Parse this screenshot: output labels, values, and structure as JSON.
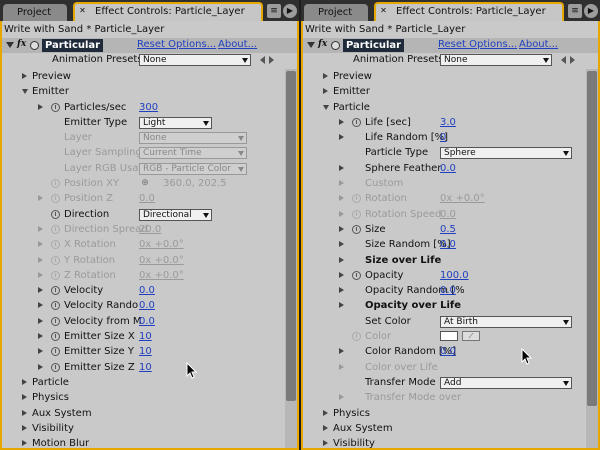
{
  "left": {
    "tabs": {
      "project": "Project",
      "effect_controls": "Effect Controls: Particle_Layer"
    },
    "breadcrumb": "Write with Sand * Particle_Layer",
    "effect": {
      "name": "Particular",
      "reset": "Reset Options...",
      "about": "About..."
    },
    "presets": {
      "label": "Animation Presets:",
      "value": "None"
    },
    "rows": [
      {
        "name": "preview",
        "label": "Preview",
        "indent": 0,
        "tri": "r"
      },
      {
        "name": "emitter",
        "label": "Emitter",
        "indent": 0,
        "tri": "d"
      },
      {
        "name": "particles-sec",
        "label": "Particles/sec",
        "indent": 1,
        "tri": "r",
        "sw": true,
        "value": "300"
      },
      {
        "name": "emitter-type",
        "label": "Emitter Type",
        "indent": 1,
        "dd": "Light"
      },
      {
        "name": "layer",
        "label": "Layer",
        "indent": 1,
        "dis": true,
        "dd": "None"
      },
      {
        "name": "layer-sampling",
        "label": "Layer Sampling",
        "indent": 1,
        "dis": true,
        "dd": "Current Time"
      },
      {
        "name": "layer-rgb-usage",
        "label": "Layer RGB Usage",
        "indent": 1,
        "dis": true,
        "dd": "RGB - Particle Color"
      },
      {
        "name": "position-xy",
        "label": "Position XY",
        "indent": 1,
        "dis": true,
        "sw": true,
        "xy": "360.0, 202.5"
      },
      {
        "name": "position-z",
        "label": "Position Z",
        "indent": 1,
        "dis": true,
        "tri": "r",
        "sw": true,
        "value": "0.0"
      },
      {
        "name": "direction",
        "label": "Direction",
        "indent": 1,
        "sw": true,
        "dd": "Directional"
      },
      {
        "name": "direction-spread",
        "label": "Direction Spread",
        "indent": 1,
        "dis": true,
        "tri": "r",
        "sw": true,
        "value": "20.0"
      },
      {
        "name": "x-rotation",
        "label": "X Rotation",
        "indent": 1,
        "dis": true,
        "tri": "r",
        "sw": true,
        "value": "0x +0.0°"
      },
      {
        "name": "y-rotation",
        "label": "Y Rotation",
        "indent": 1,
        "dis": true,
        "tri": "r",
        "sw": true,
        "value": "0x +0.0°"
      },
      {
        "name": "z-rotation",
        "label": "Z Rotation",
        "indent": 1,
        "dis": true,
        "tri": "r",
        "sw": true,
        "value": "0x +0.0°"
      },
      {
        "name": "velocity",
        "label": "Velocity",
        "indent": 1,
        "tri": "r",
        "sw": true,
        "value": "0.0"
      },
      {
        "name": "velocity-random",
        "label": "Velocity Rando",
        "indent": 1,
        "tri": "r",
        "sw": true,
        "value": "0.0"
      },
      {
        "name": "velocity-from-motion",
        "label": "Velocity from M",
        "indent": 1,
        "tri": "r",
        "sw": true,
        "value": "0.0"
      },
      {
        "name": "emitter-size-x",
        "label": "Emitter Size X",
        "indent": 1,
        "tri": "r",
        "sw": true,
        "value": "10"
      },
      {
        "name": "emitter-size-y",
        "label": "Emitter Size Y",
        "indent": 1,
        "tri": "r",
        "sw": true,
        "value": "10"
      },
      {
        "name": "emitter-size-z",
        "label": "Emitter Size Z",
        "indent": 1,
        "tri": "r",
        "sw": true,
        "value": "10"
      },
      {
        "name": "particle",
        "label": "Particle",
        "indent": 0,
        "tri": "r"
      },
      {
        "name": "physics",
        "label": "Physics",
        "indent": 0,
        "tri": "r"
      },
      {
        "name": "aux-system",
        "label": "Aux System",
        "indent": 0,
        "tri": "r"
      },
      {
        "name": "visibility",
        "label": "Visibility",
        "indent": 0,
        "tri": "r"
      },
      {
        "name": "motion-blur",
        "label": "Motion Blur",
        "indent": 0,
        "tri": "r"
      }
    ]
  },
  "right": {
    "tabs": {
      "project": "Project",
      "effect_controls": "Effect Controls: Particle_Layer"
    },
    "breadcrumb": "Write with Sand * Particle_Layer",
    "effect": {
      "name": "Particular",
      "reset": "Reset Options...",
      "about": "About..."
    },
    "presets": {
      "label": "Animation Presets:",
      "value": "None"
    },
    "rows": [
      {
        "name": "preview",
        "label": "Preview",
        "indent": 0,
        "tri": "r"
      },
      {
        "name": "emitter",
        "label": "Emitter",
        "indent": 0,
        "tri": "r"
      },
      {
        "name": "particle",
        "label": "Particle",
        "indent": 0,
        "tri": "d"
      },
      {
        "name": "life-sec",
        "label": "Life [sec]",
        "indent": 1,
        "tri": "r",
        "sw": true,
        "value": "3.0"
      },
      {
        "name": "life-random",
        "label": "Life Random [%]",
        "indent": 1,
        "tri": "r",
        "value": "0"
      },
      {
        "name": "particle-type",
        "label": "Particle Type",
        "indent": 1,
        "dd": "Sphere"
      },
      {
        "name": "sphere-feather",
        "label": "Sphere Feather",
        "indent": 1,
        "tri": "r",
        "value": "0.0"
      },
      {
        "name": "custom",
        "label": "Custom",
        "indent": 1,
        "dis": true,
        "tri": "r"
      },
      {
        "name": "rotation",
        "label": "Rotation",
        "indent": 1,
        "dis": true,
        "tri": "r",
        "sw": true,
        "value": "0x +0.0°"
      },
      {
        "name": "rotation-speed",
        "label": "Rotation Speed",
        "indent": 1,
        "dis": true,
        "tri": "r",
        "sw": true,
        "value": "0.0"
      },
      {
        "name": "size",
        "label": "Size",
        "indent": 1,
        "tri": "r",
        "sw": true,
        "value": "0.5"
      },
      {
        "name": "size-random",
        "label": "Size Random [%]",
        "indent": 1,
        "tri": "r",
        "value": "0.0"
      },
      {
        "name": "size-over-life",
        "label": "Size over Life",
        "indent": 1,
        "bold": true,
        "tri": "r"
      },
      {
        "name": "opacity",
        "label": "Opacity",
        "indent": 1,
        "tri": "r",
        "sw": true,
        "value": "100.0"
      },
      {
        "name": "opacity-random",
        "label": "Opacity Random [%",
        "indent": 1,
        "tri": "r",
        "value": "0.0"
      },
      {
        "name": "opacity-over-life",
        "label": "Opacity over Life",
        "indent": 1,
        "bold": true,
        "tri": "r"
      },
      {
        "name": "set-color",
        "label": "Set Color",
        "indent": 1,
        "dd": "At Birth"
      },
      {
        "name": "color",
        "label": "Color",
        "indent": 1,
        "dis": true,
        "sw": true,
        "color": true
      },
      {
        "name": "color-random",
        "label": "Color Random [%]",
        "indent": 1,
        "tri": "r",
        "value": "0.0"
      },
      {
        "name": "color-over-life",
        "label": "Color over Life",
        "indent": 1,
        "dis": true,
        "tri": "r"
      },
      {
        "name": "transfer-mode",
        "label": "Transfer Mode",
        "indent": 1,
        "dd": "Add"
      },
      {
        "name": "transfer-mode-over",
        "label": "Transfer Mode over",
        "indent": 1,
        "dis": true,
        "tri": "r"
      },
      {
        "name": "physics",
        "label": "Physics",
        "indent": 0,
        "tri": "r"
      },
      {
        "name": "aux-system",
        "label": "Aux System",
        "indent": 0,
        "tri": "r"
      },
      {
        "name": "visibility",
        "label": "Visibility",
        "indent": 0,
        "tri": "r"
      }
    ]
  },
  "colors": {
    "accent": "#e6a800",
    "link": "#2040c0",
    "panel": "#c9c9c9",
    "effect_badge": "#1f2a3a"
  }
}
